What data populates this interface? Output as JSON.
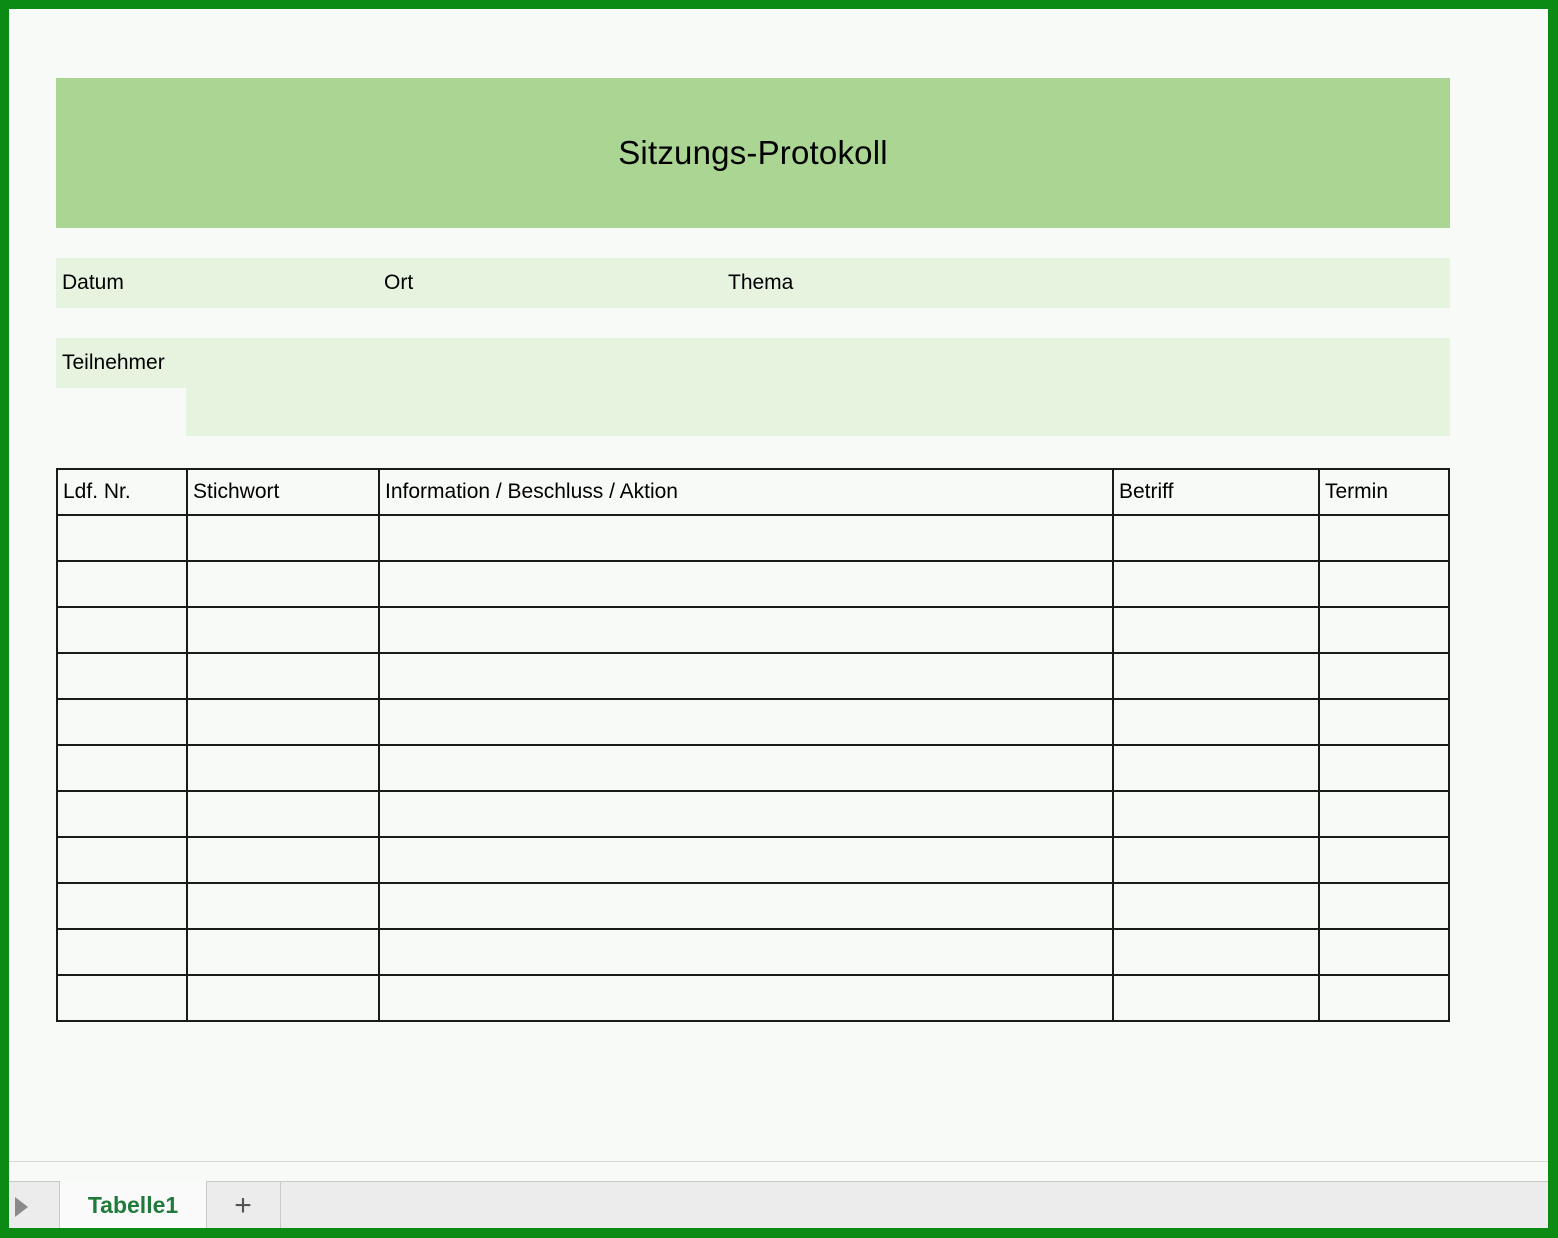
{
  "sheet": {
    "title": "Sitzungs-Protokoll",
    "info": {
      "datum": "Datum",
      "ort": "Ort",
      "thema": "Thema"
    },
    "teilnehmer": "Teilnehmer",
    "table": {
      "headers": [
        "Ldf. Nr.",
        "Stichwort",
        "Information / Beschluss / Aktion",
        "Betriff",
        "Termin"
      ],
      "empty_rows": 11
    }
  },
  "tabs": {
    "active": "Tabelle1",
    "add": "+"
  },
  "colors": {
    "frame": "#0b8a14",
    "title_band": "#aad592",
    "light_band": "#e5f3df",
    "tab_text": "#1f7a3c"
  },
  "icons": {
    "scroll": "play-triangle-icon",
    "add": "plus-icon"
  }
}
